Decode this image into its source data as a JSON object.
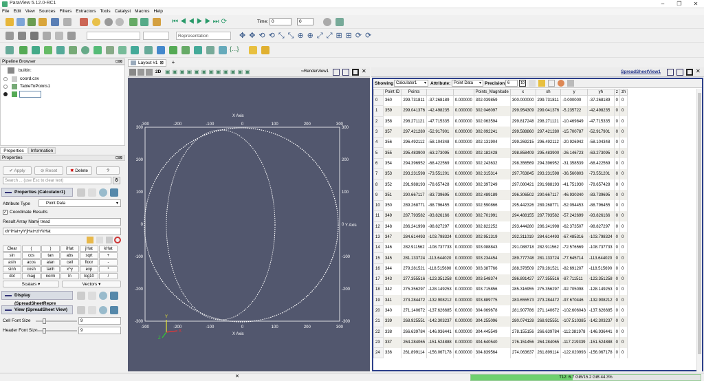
{
  "window": {
    "title": "ParaView 5.12.0-RC1"
  },
  "menu": [
    "File",
    "Edit",
    "View",
    "Sources",
    "Filters",
    "Extractors",
    "Tools",
    "Catalyst",
    "Macros",
    "Help"
  ],
  "toolbar": {
    "time_label": "Time:",
    "time_value": "0",
    "time_index": "0",
    "representation": "Representation"
  },
  "pipeline": {
    "title": "Pipeline Browser",
    "items": [
      "builtin:",
      "coord.csv",
      "TableToPoints1",
      ""
    ]
  },
  "props": {
    "tab_properties": "Properties",
    "tab_information": "Information",
    "header": "Properties",
    "apply": "Apply",
    "reset": "Reset",
    "delete": "Delete",
    "help": "?",
    "search_placeholder": "Search ... (use Esc to clear text)",
    "section_props": "Properties (Calculator1)",
    "attribute_type_label": "Attribute Type",
    "attribute_type": "Point Data",
    "coord_results": "Coordinate Results",
    "result_name_label": "Result Array Name",
    "result_name": "tread",
    "expression": "xh*iHat+yh*jHat+zh*kHat",
    "calc_buttons": [
      "Clear",
      "(",
      ")",
      "iHat",
      "jHat",
      "kHat",
      "sin",
      "cos",
      "tan",
      "abs",
      "sqrt",
      "+",
      "asin",
      "acos",
      "atan",
      "ceil",
      "floor",
      "-",
      "sinh",
      "cosh",
      "tanh",
      "x^y",
      "exp",
      "*",
      "dot",
      "mag",
      "norm",
      "ln",
      "log10",
      "/"
    ],
    "scalars": "Scalars",
    "vectors": "Vectors",
    "section_display": "Display (SpreadSheetRepre",
    "section_view": "View (SpreadSheet View)",
    "cell_font_label": "Cell Font Size",
    "cell_font": "9",
    "header_font_label": "Header Font Size",
    "header_font": "9"
  },
  "layout": {
    "tab": "Layout #1",
    "add": "+",
    "render_label": "RenderView1",
    "ss_label": "SpreadSheetView1",
    "mode_2d": "2D"
  },
  "render": {
    "x_title": "X Axis",
    "y_title": "Y Axis",
    "ticks": [
      "-300",
      "-200",
      "-100",
      "0",
      "100",
      "200",
      "300"
    ],
    "axes": [
      "X",
      "Y",
      "Z"
    ]
  },
  "spreadsheet": {
    "showing_label": "Showing",
    "showing": "Calculator1",
    "attribute_label": "Attribute:",
    "attribute": "Point Data",
    "precision_label": "Precision:",
    "precision": "6",
    "columns": [
      "Point ID",
      "Points",
      "",
      "",
      "Points_Magnitude",
      "x",
      "xh",
      "y",
      "yh",
      "z",
      "zh"
    ],
    "rows": [
      [
        "0",
        "360",
        "299.731811",
        "-37.268189",
        "0.000000",
        "302.039859",
        "300.000000",
        "299.731811",
        "-0.000000",
        "-37.268189",
        "0",
        "0"
      ],
      [
        "1",
        "359",
        "299.041376",
        "-42.498235",
        "0.000000",
        "302.046097",
        "299.954309",
        "299.041376",
        "-5.235722",
        "-42.498235",
        "0",
        "0"
      ],
      [
        "2",
        "358",
        "298.271121",
        "-47.715335",
        "0.000000",
        "302.063594",
        "299.817248",
        "298.271121",
        "-10.469849",
        "-47.715335",
        "0",
        "0"
      ],
      [
        "3",
        "357",
        "297.421280",
        "-52.917901",
        "0.000000",
        "302.092241",
        "299.588860",
        "297.421280",
        "-15.700787",
        "-52.917901",
        "0",
        "0"
      ],
      [
        "4",
        "356",
        "296.492112",
        "-58.104348",
        "0.000000",
        "302.131904",
        "299.269215",
        "296.492112",
        "-20.926942",
        "-58.104348",
        "0",
        "0"
      ],
      [
        "5",
        "355",
        "295.483900",
        "-63.273095",
        "0.000000",
        "302.182428",
        "298.858409",
        "295.483900",
        "-26.146723",
        "-63.273095",
        "0",
        "0"
      ],
      [
        "6",
        "354",
        "294.396952",
        "-68.422569",
        "0.000000",
        "302.243632",
        "298.356569",
        "294.396952",
        "-31.358539",
        "-68.422569",
        "0",
        "0"
      ],
      [
        "7",
        "353",
        "293.231598",
        "-73.551201",
        "0.000000",
        "302.315314",
        "297.763845",
        "293.231598",
        "-36.560803",
        "-73.551201",
        "0",
        "0"
      ],
      [
        "8",
        "352",
        "291.988193",
        "-78.657428",
        "0.000000",
        "302.397249",
        "297.080421",
        "291.988193",
        "-41.751930",
        "-78.657428",
        "0",
        "0"
      ],
      [
        "9",
        "351",
        "290.667117",
        "-83.739695",
        "0.000000",
        "302.489189",
        "296.306502",
        "290.667117",
        "-46.930340",
        "-83.739695",
        "0",
        "0"
      ],
      [
        "10",
        "350",
        "289.268771",
        "-88.796455",
        "0.000000",
        "302.590866",
        "295.442326",
        "289.268771",
        "-52.094453",
        "-88.796455",
        "0",
        "0"
      ],
      [
        "11",
        "349",
        "287.793582",
        "-93.826166",
        "0.000000",
        "302.701991",
        "294.488155",
        "287.793582",
        "-57.242699",
        "-93.826166",
        "0",
        "0"
      ],
      [
        "12",
        "348",
        "286.241998",
        "-98.827297",
        "0.000000",
        "302.822252",
        "293.444280",
        "286.241998",
        "-62.373507",
        "-98.827297",
        "0",
        "0"
      ],
      [
        "13",
        "347",
        "284.614493",
        "-103.798324",
        "0.000000",
        "302.951319",
        "292.311019",
        "284.614493",
        "-67.485316",
        "-103.798324",
        "0",
        "0"
      ],
      [
        "14",
        "346",
        "282.911562",
        "-108.737733",
        "0.000000",
        "303.088843",
        "291.088718",
        "282.911562",
        "-72.576569",
        "-108.737733",
        "0",
        "0"
      ],
      [
        "15",
        "345",
        "281.133724",
        "-113.644020",
        "0.000000",
        "303.234454",
        "289.777748",
        "281.133724",
        "-77.645714",
        "-113.644020",
        "0",
        "0"
      ],
      [
        "16",
        "344",
        "279.281521",
        "-118.515690",
        "0.000000",
        "303.387766",
        "288.378509",
        "279.281521",
        "-82.691207",
        "-118.515690",
        "0",
        "0"
      ],
      [
        "17",
        "343",
        "277.355516",
        "-123.351258",
        "0.000000",
        "303.548374",
        "286.891427",
        "277.355516",
        "-87.711511",
        "-123.351258",
        "0",
        "0"
      ],
      [
        "18",
        "342",
        "275.356297",
        "-128.149253",
        "0.000000",
        "303.715856",
        "285.316955",
        "275.356297",
        "-92.705098",
        "-128.149253",
        "0",
        "0"
      ],
      [
        "19",
        "341",
        "273.284472",
        "-132.908212",
        "0.000000",
        "303.889775",
        "283.655573",
        "273.284472",
        "-97.670446",
        "-132.908212",
        "0",
        "0"
      ],
      [
        "20",
        "340",
        "271.140672",
        "-137.626685",
        "0.000000",
        "304.069678",
        "281.907786",
        "271.140672",
        "-102.606043",
        "-137.626685",
        "0",
        "0"
      ],
      [
        "21",
        "339",
        "268.925551",
        "-142.303237",
        "0.000000",
        "304.255096",
        "280.074128",
        "268.925551",
        "-107.510385",
        "-142.303237",
        "0",
        "0"
      ],
      [
        "22",
        "338",
        "266.639784",
        "-146.936441",
        "0.000000",
        "304.445549",
        "278.155156",
        "266.639784",
        "-112.381978",
        "-146.936441",
        "0",
        "0"
      ],
      [
        "23",
        "337",
        "264.284065",
        "-151.524888",
        "0.000000",
        "304.640540",
        "276.151456",
        "264.284065",
        "-117.219339",
        "-151.524888",
        "0",
        "0"
      ],
      [
        "24",
        "336",
        "261.899114",
        "-156.067178",
        "0.000000",
        "304.839564",
        "274.063637",
        "261.899114",
        "-122.020993",
        "-156.067178",
        "0",
        "0"
      ]
    ]
  },
  "status": {
    "memory": "T12: 6.7 GiB/15.2 GiB 44.3%",
    "memory_fraction": 0.443,
    "close": "✕"
  }
}
